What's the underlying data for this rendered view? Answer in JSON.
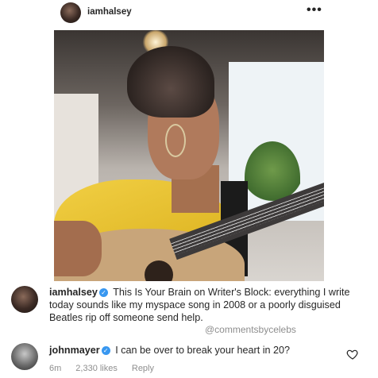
{
  "post": {
    "username": "iamhalsey",
    "more_label": "•••"
  },
  "caption": {
    "username": "iamhalsey",
    "text": "This Is Your Brain on Writer's Block: everything I write today sounds like my myspace song in 2008 or a poorly disguised Beatles rip off someone send help."
  },
  "watermark": "@commentsbycelebs",
  "comment": {
    "username": "johnmayer",
    "text": "I can be over to break your heart in 20?",
    "time": "6m",
    "likes": "2,330 likes",
    "reply": "Reply"
  },
  "icons": {
    "verified": "verified-badge-icon",
    "like": "heart-icon",
    "more": "more-options-icon"
  },
  "colors": {
    "verified": "#3897f0",
    "meta_text": "#8e8e8e"
  }
}
